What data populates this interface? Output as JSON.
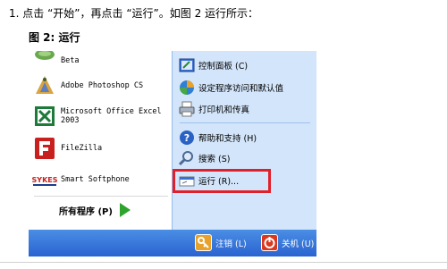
{
  "doc": {
    "step_text": "1.  点击 “开始”，再点击 “运行”。如图 2 运行所示：",
    "figure_title": "图 2: 运行"
  },
  "left_programs": [
    {
      "label": "Beta",
      "icon": "beta-app-icon"
    },
    {
      "label": "Adobe Photoshop CS",
      "icon": "photoshop-icon"
    },
    {
      "label": "Microsoft Office Excel 2003",
      "icon": "excel-icon"
    },
    {
      "label": "FileZilla",
      "icon": "filezilla-icon"
    },
    {
      "label": "Smart Softphone",
      "icon": "sykes-icon",
      "icon_text": "SYKES"
    }
  ],
  "all_programs": {
    "label": "所有程序 (P)"
  },
  "right_items": [
    {
      "label": "控制面板 (C)",
      "icon": "control-panel-icon"
    },
    {
      "label": "设定程序访问和默认值",
      "icon": "program-access-icon"
    },
    {
      "label": "打印机和传真",
      "icon": "printer-icon"
    },
    {
      "label": "帮助和支持 (H)",
      "icon": "help-icon"
    },
    {
      "label": "搜索 (S)",
      "icon": "search-icon"
    },
    {
      "label": "运行 (R)...",
      "icon": "run-icon"
    }
  ],
  "bottom": {
    "logoff_label": "注销 (L)",
    "shutdown_label": "关机 (U)"
  },
  "colors": {
    "highlight": "#e0202a",
    "right_pane": "#d3e5fa",
    "bottom_bar": "#2a63d0"
  }
}
